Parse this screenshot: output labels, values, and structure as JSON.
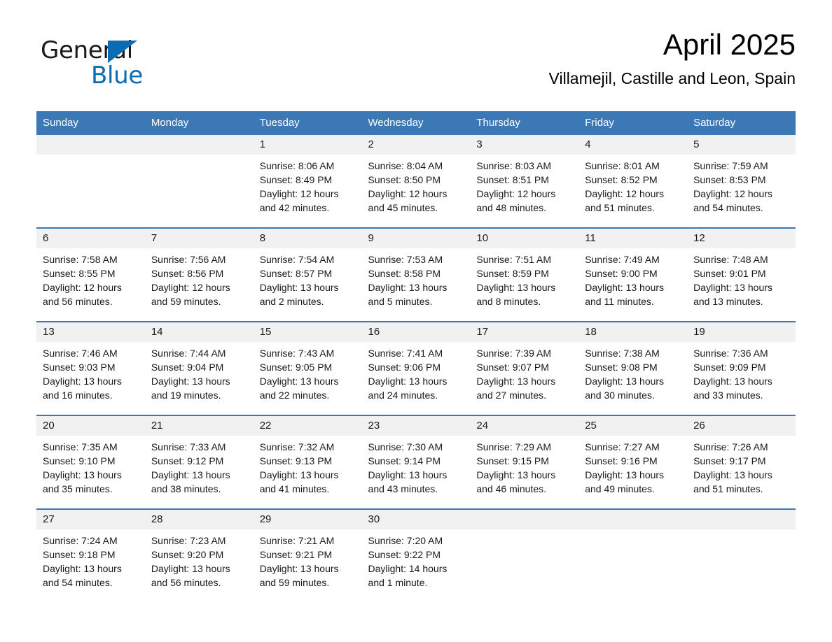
{
  "logo": {
    "word_one": "General",
    "word_two": "Blue",
    "triangle_icon": "triangle-icon",
    "brand_blue": "#0a6cb4"
  },
  "header": {
    "title": "April 2025",
    "subtitle": "Villamejil, Castille and Leon, Spain"
  },
  "colors": {
    "header_blue": "#3b78b5",
    "row_band_gray": "#f1f1f1",
    "text": "#1a1a1a"
  },
  "calendar": {
    "weekday_headers": [
      "Sunday",
      "Monday",
      "Tuesday",
      "Wednesday",
      "Thursday",
      "Friday",
      "Saturday"
    ],
    "weeks": [
      [
        {
          "day": "",
          "sunrise": "",
          "sunset": "",
          "daylight_line1": "",
          "daylight_line2": ""
        },
        {
          "day": "",
          "sunrise": "",
          "sunset": "",
          "daylight_line1": "",
          "daylight_line2": ""
        },
        {
          "day": "1",
          "sunrise": "Sunrise: 8:06 AM",
          "sunset": "Sunset: 8:49 PM",
          "daylight_line1": "Daylight: 12 hours",
          "daylight_line2": "and 42 minutes."
        },
        {
          "day": "2",
          "sunrise": "Sunrise: 8:04 AM",
          "sunset": "Sunset: 8:50 PM",
          "daylight_line1": "Daylight: 12 hours",
          "daylight_line2": "and 45 minutes."
        },
        {
          "day": "3",
          "sunrise": "Sunrise: 8:03 AM",
          "sunset": "Sunset: 8:51 PM",
          "daylight_line1": "Daylight: 12 hours",
          "daylight_line2": "and 48 minutes."
        },
        {
          "day": "4",
          "sunrise": "Sunrise: 8:01 AM",
          "sunset": "Sunset: 8:52 PM",
          "daylight_line1": "Daylight: 12 hours",
          "daylight_line2": "and 51 minutes."
        },
        {
          "day": "5",
          "sunrise": "Sunrise: 7:59 AM",
          "sunset": "Sunset: 8:53 PM",
          "daylight_line1": "Daylight: 12 hours",
          "daylight_line2": "and 54 minutes."
        }
      ],
      [
        {
          "day": "6",
          "sunrise": "Sunrise: 7:58 AM",
          "sunset": "Sunset: 8:55 PM",
          "daylight_line1": "Daylight: 12 hours",
          "daylight_line2": "and 56 minutes."
        },
        {
          "day": "7",
          "sunrise": "Sunrise: 7:56 AM",
          "sunset": "Sunset: 8:56 PM",
          "daylight_line1": "Daylight: 12 hours",
          "daylight_line2": "and 59 minutes."
        },
        {
          "day": "8",
          "sunrise": "Sunrise: 7:54 AM",
          "sunset": "Sunset: 8:57 PM",
          "daylight_line1": "Daylight: 13 hours",
          "daylight_line2": "and 2 minutes."
        },
        {
          "day": "9",
          "sunrise": "Sunrise: 7:53 AM",
          "sunset": "Sunset: 8:58 PM",
          "daylight_line1": "Daylight: 13 hours",
          "daylight_line2": "and 5 minutes."
        },
        {
          "day": "10",
          "sunrise": "Sunrise: 7:51 AM",
          "sunset": "Sunset: 8:59 PM",
          "daylight_line1": "Daylight: 13 hours",
          "daylight_line2": "and 8 minutes."
        },
        {
          "day": "11",
          "sunrise": "Sunrise: 7:49 AM",
          "sunset": "Sunset: 9:00 PM",
          "daylight_line1": "Daylight: 13 hours",
          "daylight_line2": "and 11 minutes."
        },
        {
          "day": "12",
          "sunrise": "Sunrise: 7:48 AM",
          "sunset": "Sunset: 9:01 PM",
          "daylight_line1": "Daylight: 13 hours",
          "daylight_line2": "and 13 minutes."
        }
      ],
      [
        {
          "day": "13",
          "sunrise": "Sunrise: 7:46 AM",
          "sunset": "Sunset: 9:03 PM",
          "daylight_line1": "Daylight: 13 hours",
          "daylight_line2": "and 16 minutes."
        },
        {
          "day": "14",
          "sunrise": "Sunrise: 7:44 AM",
          "sunset": "Sunset: 9:04 PM",
          "daylight_line1": "Daylight: 13 hours",
          "daylight_line2": "and 19 minutes."
        },
        {
          "day": "15",
          "sunrise": "Sunrise: 7:43 AM",
          "sunset": "Sunset: 9:05 PM",
          "daylight_line1": "Daylight: 13 hours",
          "daylight_line2": "and 22 minutes."
        },
        {
          "day": "16",
          "sunrise": "Sunrise: 7:41 AM",
          "sunset": "Sunset: 9:06 PM",
          "daylight_line1": "Daylight: 13 hours",
          "daylight_line2": "and 24 minutes."
        },
        {
          "day": "17",
          "sunrise": "Sunrise: 7:39 AM",
          "sunset": "Sunset: 9:07 PM",
          "daylight_line1": "Daylight: 13 hours",
          "daylight_line2": "and 27 minutes."
        },
        {
          "day": "18",
          "sunrise": "Sunrise: 7:38 AM",
          "sunset": "Sunset: 9:08 PM",
          "daylight_line1": "Daylight: 13 hours",
          "daylight_line2": "and 30 minutes."
        },
        {
          "day": "19",
          "sunrise": "Sunrise: 7:36 AM",
          "sunset": "Sunset: 9:09 PM",
          "daylight_line1": "Daylight: 13 hours",
          "daylight_line2": "and 33 minutes."
        }
      ],
      [
        {
          "day": "20",
          "sunrise": "Sunrise: 7:35 AM",
          "sunset": "Sunset: 9:10 PM",
          "daylight_line1": "Daylight: 13 hours",
          "daylight_line2": "and 35 minutes."
        },
        {
          "day": "21",
          "sunrise": "Sunrise: 7:33 AM",
          "sunset": "Sunset: 9:12 PM",
          "daylight_line1": "Daylight: 13 hours",
          "daylight_line2": "and 38 minutes."
        },
        {
          "day": "22",
          "sunrise": "Sunrise: 7:32 AM",
          "sunset": "Sunset: 9:13 PM",
          "daylight_line1": "Daylight: 13 hours",
          "daylight_line2": "and 41 minutes."
        },
        {
          "day": "23",
          "sunrise": "Sunrise: 7:30 AM",
          "sunset": "Sunset: 9:14 PM",
          "daylight_line1": "Daylight: 13 hours",
          "daylight_line2": "and 43 minutes."
        },
        {
          "day": "24",
          "sunrise": "Sunrise: 7:29 AM",
          "sunset": "Sunset: 9:15 PM",
          "daylight_line1": "Daylight: 13 hours",
          "daylight_line2": "and 46 minutes."
        },
        {
          "day": "25",
          "sunrise": "Sunrise: 7:27 AM",
          "sunset": "Sunset: 9:16 PM",
          "daylight_line1": "Daylight: 13 hours",
          "daylight_line2": "and 49 minutes."
        },
        {
          "day": "26",
          "sunrise": "Sunrise: 7:26 AM",
          "sunset": "Sunset: 9:17 PM",
          "daylight_line1": "Daylight: 13 hours",
          "daylight_line2": "and 51 minutes."
        }
      ],
      [
        {
          "day": "27",
          "sunrise": "Sunrise: 7:24 AM",
          "sunset": "Sunset: 9:18 PM",
          "daylight_line1": "Daylight: 13 hours",
          "daylight_line2": "and 54 minutes."
        },
        {
          "day": "28",
          "sunrise": "Sunrise: 7:23 AM",
          "sunset": "Sunset: 9:20 PM",
          "daylight_line1": "Daylight: 13 hours",
          "daylight_line2": "and 56 minutes."
        },
        {
          "day": "29",
          "sunrise": "Sunrise: 7:21 AM",
          "sunset": "Sunset: 9:21 PM",
          "daylight_line1": "Daylight: 13 hours",
          "daylight_line2": "and 59 minutes."
        },
        {
          "day": "30",
          "sunrise": "Sunrise: 7:20 AM",
          "sunset": "Sunset: 9:22 PM",
          "daylight_line1": "Daylight: 14 hours",
          "daylight_line2": "and 1 minute."
        },
        {
          "day": "",
          "sunrise": "",
          "sunset": "",
          "daylight_line1": "",
          "daylight_line2": ""
        },
        {
          "day": "",
          "sunrise": "",
          "sunset": "",
          "daylight_line1": "",
          "daylight_line2": ""
        },
        {
          "day": "",
          "sunrise": "",
          "sunset": "",
          "daylight_line1": "",
          "daylight_line2": ""
        }
      ]
    ]
  }
}
